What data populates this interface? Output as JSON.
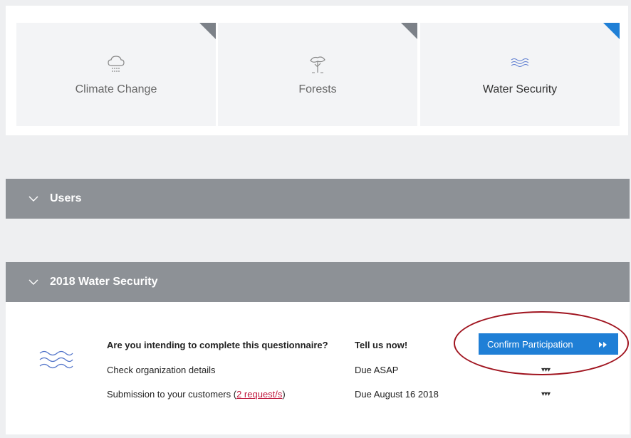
{
  "topics": [
    {
      "label": "Climate Change",
      "icon": "cloud-rain-icon",
      "active": false
    },
    {
      "label": "Forests",
      "icon": "tree-icon",
      "active": false
    },
    {
      "label": "Water Security",
      "icon": "waves-icon",
      "active": true
    }
  ],
  "sections": {
    "users": {
      "title": "Users"
    },
    "water": {
      "title": "2018 Water Security"
    }
  },
  "questionnaire": {
    "rows": [
      {
        "task": "Are you intending to complete this questionnaire?",
        "due": "Tell us now!"
      },
      {
        "task": "Check organization details",
        "due": "Due ASAP"
      },
      {
        "task_prefix": "Submission to your customers (",
        "link": "2 request/s",
        "task_suffix": ")",
        "due": "Due August 16 2018"
      }
    ],
    "confirm_label": "Confirm Participation",
    "more_glyph": "▾▾▾"
  },
  "colors": {
    "accent": "#1f7fd6",
    "corner_inactive": "#7c8188",
    "section_bar": "#8d9196",
    "link": "#c0183e",
    "highlight": "#a0141f"
  }
}
